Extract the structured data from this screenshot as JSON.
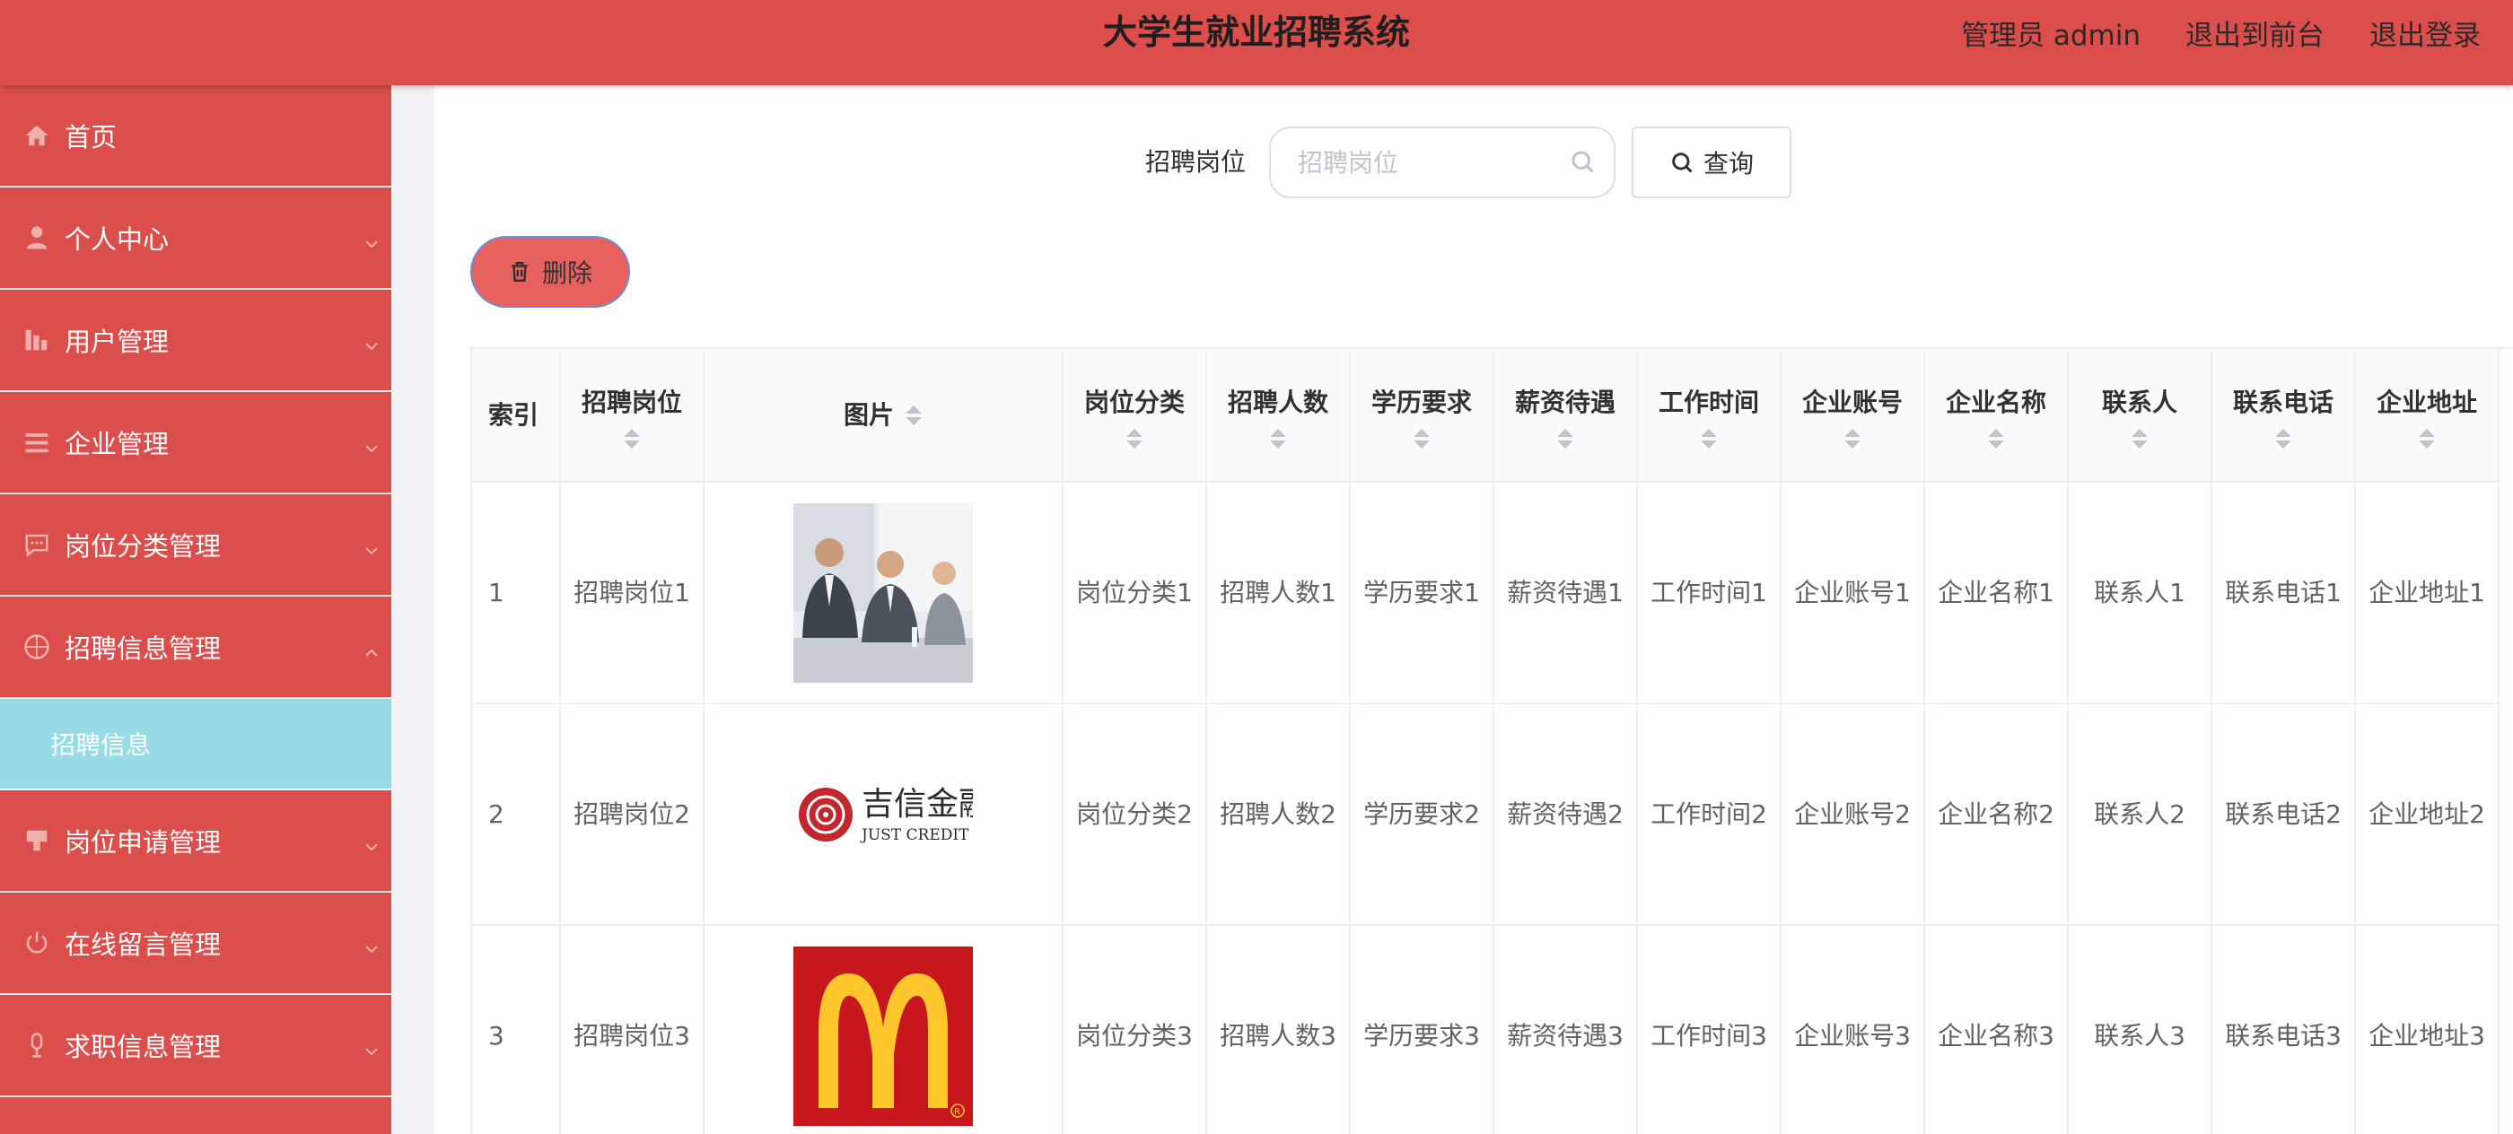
{
  "header": {
    "title": "大学生就业招聘系统",
    "admin_label": "管理员 admin",
    "exit_front_label": "退出到前台",
    "logout_label": "退出登录"
  },
  "sidebar": {
    "items": [
      {
        "label": "首页",
        "icon": "home-icon"
      },
      {
        "label": "个人中心",
        "icon": "user-icon"
      },
      {
        "label": "用户管理",
        "icon": "chart-icon"
      },
      {
        "label": "企业管理",
        "icon": "list-icon"
      },
      {
        "label": "岗位分类管理",
        "icon": "chat-icon"
      },
      {
        "label": "招聘信息管理",
        "icon": "compass-icon"
      },
      {
        "label": "岗位申请管理",
        "icon": "tag-icon"
      },
      {
        "label": "在线留言管理",
        "icon": "power-icon"
      },
      {
        "label": "求职信息管理",
        "icon": "microphone-icon"
      }
    ],
    "active_submenu": "招聘信息"
  },
  "search": {
    "label": "招聘岗位",
    "placeholder": "招聘岗位",
    "button_label": "查询"
  },
  "toolbar": {
    "delete_label": "删除"
  },
  "table": {
    "headers": [
      "索引",
      "招聘岗位",
      "图片",
      "岗位分类",
      "招聘人数",
      "学历要求",
      "薪资待遇",
      "工作时间",
      "企业账号",
      "企业名称",
      "联系人",
      "联系电话",
      "企业地址"
    ],
    "rows": [
      {
        "index": "1",
        "position": "招聘岗位1",
        "image": "business-meeting-photo",
        "category": "岗位分类1",
        "count": "招聘人数1",
        "education": "学历要求1",
        "salary": "薪资待遇1",
        "worktime": "工作时间1",
        "account": "企业账号1",
        "company": "企业名称1",
        "contact": "联系人1",
        "phone": "联系电话1",
        "address": "企业地址1"
      },
      {
        "index": "2",
        "position": "招聘岗位2",
        "image": "just-credit-logo",
        "image_text_cn": "吉信金融",
        "image_text_en": "JUST CREDIT",
        "category": "岗位分类2",
        "count": "招聘人数2",
        "education": "学历要求2",
        "salary": "薪资待遇2",
        "worktime": "工作时间2",
        "account": "企业账号2",
        "company": "企业名称2",
        "contact": "联系人2",
        "phone": "联系电话2",
        "address": "企业地址2"
      },
      {
        "index": "3",
        "position": "招聘岗位3",
        "image": "mcdonalds-logo",
        "category": "岗位分类3",
        "count": "招聘人数3",
        "education": "学历要求3",
        "salary": "薪资待遇3",
        "worktime": "工作时间3",
        "account": "企业账号3",
        "company": "企业名称3",
        "contact": "联系人3",
        "phone": "联系电话3",
        "address": "企业地址3"
      }
    ]
  },
  "colors": {
    "header_bg": "#db4e4b",
    "sidebar_bg": "#db4e4b",
    "submenu_active_bg": "#97dbe6",
    "delete_button_bg": "#e7625f"
  }
}
